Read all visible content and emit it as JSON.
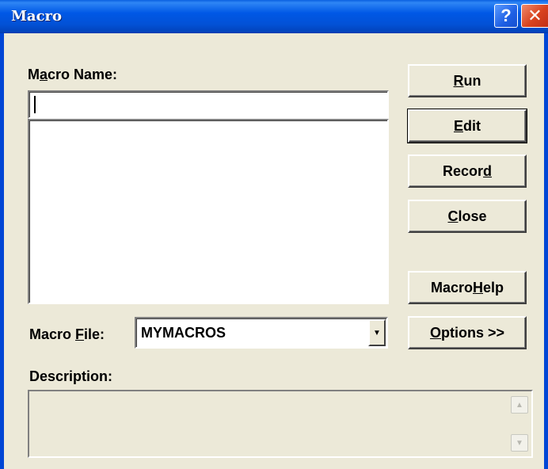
{
  "window": {
    "title": "Macro",
    "help_glyph": "?",
    "close_glyph": "✕"
  },
  "macro_name": {
    "label_pre": "M",
    "label_key": "a",
    "label_post": "cro Name:",
    "value": ""
  },
  "macro_list": {
    "items": []
  },
  "buttons": {
    "run": {
      "key": "R",
      "rest": "un"
    },
    "edit": {
      "key": "E",
      "rest": "dit"
    },
    "record": {
      "pre": "Recor",
      "key": "d"
    },
    "close": {
      "key": "C",
      "rest": "lose"
    },
    "macro_help": {
      "pre": "Macro ",
      "key": "H",
      "rest": "elp"
    },
    "options": {
      "key": "O",
      "rest": "ptions >>"
    }
  },
  "macro_file": {
    "label_pre": "Macro ",
    "label_key": "F",
    "label_post": "ile:",
    "selected": "MYMACROS"
  },
  "description": {
    "label": "Description:",
    "value": ""
  },
  "icons": {
    "dropdown": "chevron-down-icon",
    "scroll_up": "scroll-up-icon",
    "scroll_down": "scroll-down-icon"
  }
}
